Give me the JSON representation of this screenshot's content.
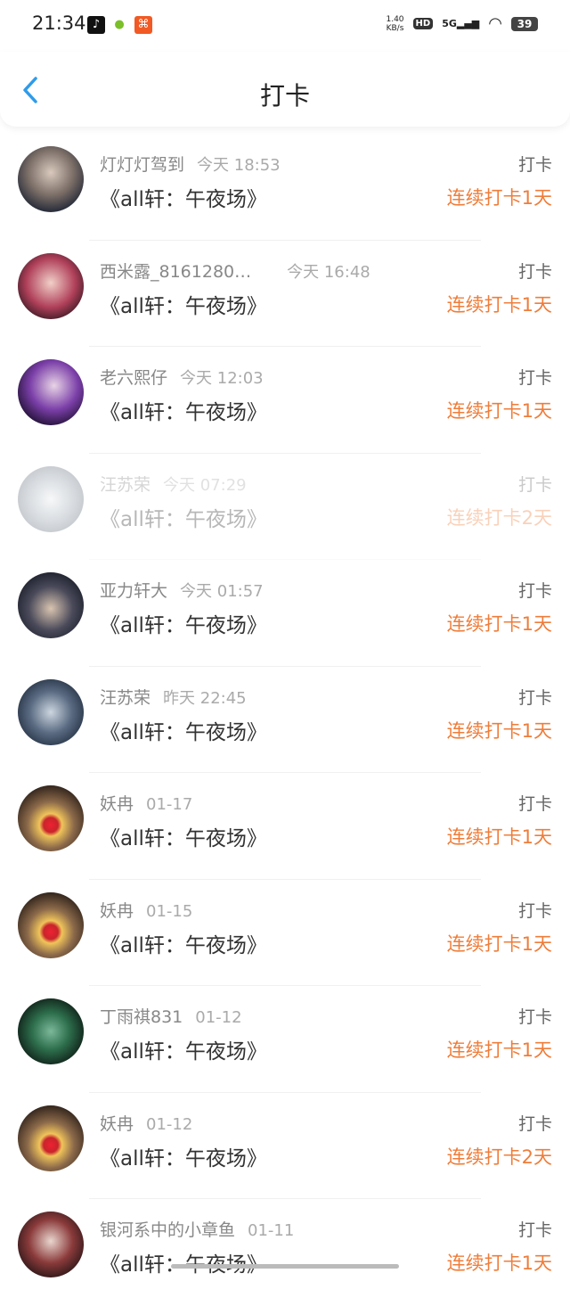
{
  "status": {
    "time": "21:34",
    "speed_value": "1.40",
    "speed_unit": "KB/s",
    "hd": "HD",
    "network": "5G",
    "battery": "39"
  },
  "nav": {
    "title": "打卡"
  },
  "items": [
    {
      "name": "灯灯灯驾到",
      "time": "今天 18:53",
      "book": "《all轩：午夜场》",
      "tag": "打卡",
      "streak": "连续打卡1天"
    },
    {
      "name": "西米露_8161280…",
      "time": "今天 16:48",
      "book": "《all轩：午夜场》",
      "tag": "打卡",
      "streak": "连续打卡1天"
    },
    {
      "name": "老六熙仔",
      "time": "今天 12:03",
      "book": "《all轩：午夜场》",
      "tag": "打卡",
      "streak": "连续打卡1天"
    },
    {
      "name": "汪苏荣",
      "time": "今天 07:29",
      "book": "《all轩：午夜场》",
      "tag": "打卡",
      "streak": "连续打卡2天"
    },
    {
      "name": "亚力轩大",
      "time": "今天 01:57",
      "book": "《all轩：午夜场》",
      "tag": "打卡",
      "streak": "连续打卡1天"
    },
    {
      "name": "汪苏荣",
      "time": "昨天 22:45",
      "book": "《all轩：午夜场》",
      "tag": "打卡",
      "streak": "连续打卡1天"
    },
    {
      "name": "妖冉",
      "time": "01-17",
      "book": "《all轩：午夜场》",
      "tag": "打卡",
      "streak": "连续打卡1天"
    },
    {
      "name": "妖冉",
      "time": "01-15",
      "book": "《all轩：午夜场》",
      "tag": "打卡",
      "streak": "连续打卡1天"
    },
    {
      "name": "丁雨祺831",
      "time": "01-12",
      "book": "《all轩：午夜场》",
      "tag": "打卡",
      "streak": "连续打卡1天"
    },
    {
      "name": "妖冉",
      "time": "01-12",
      "book": "《all轩：午夜场》",
      "tag": "打卡",
      "streak": "连续打卡2天"
    },
    {
      "name": "银河系中的小章鱼",
      "time": "01-11",
      "book": "《all轩：午夜场》",
      "tag": "打卡",
      "streak": "连续打卡1天"
    }
  ],
  "colors": {
    "accent": "#2f9bea",
    "streak": "#ef7d3a"
  }
}
